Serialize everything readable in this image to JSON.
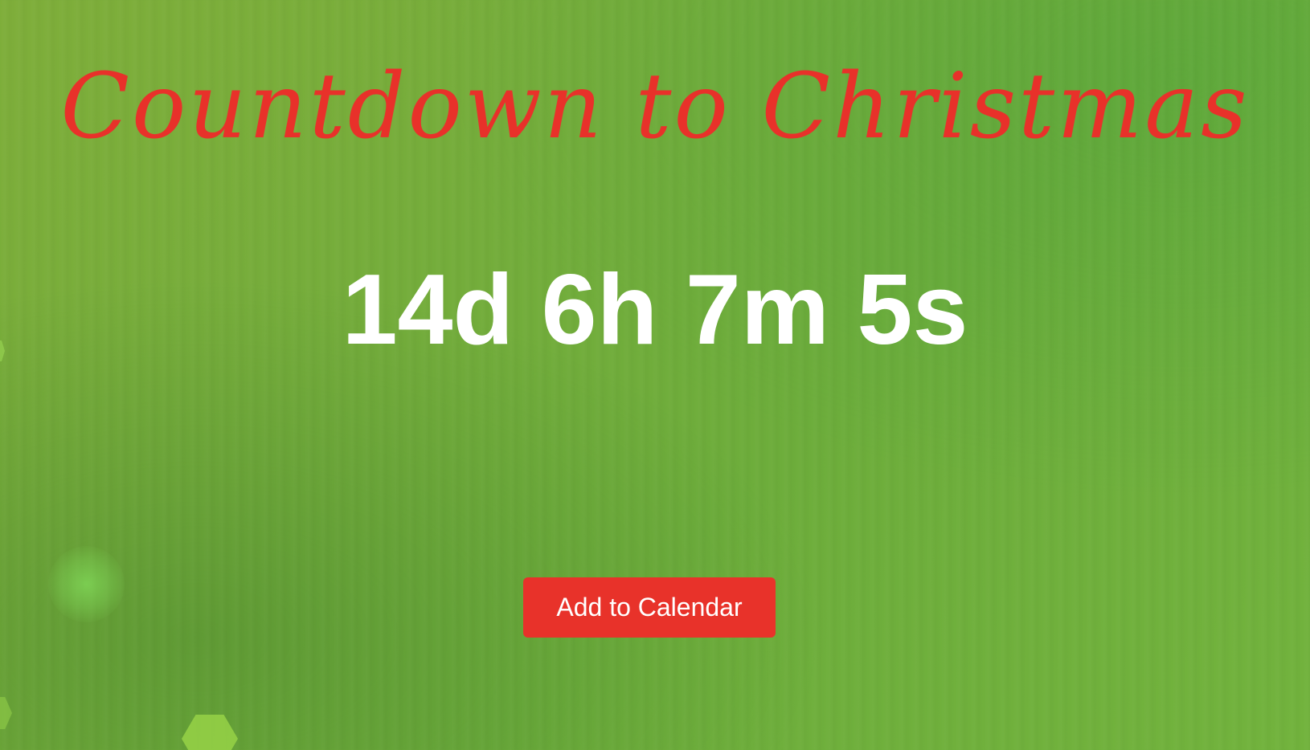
{
  "page": {
    "title": "Countdown to Christmas",
    "countdown": "14d 6h 7m 5s",
    "button_label": "Add to Calendar"
  },
  "colors": {
    "background": "#74ad3b",
    "title": "#e8312a",
    "countdown": "#ffffff",
    "button": "#e8322a",
    "button_text": "#ffffff"
  }
}
